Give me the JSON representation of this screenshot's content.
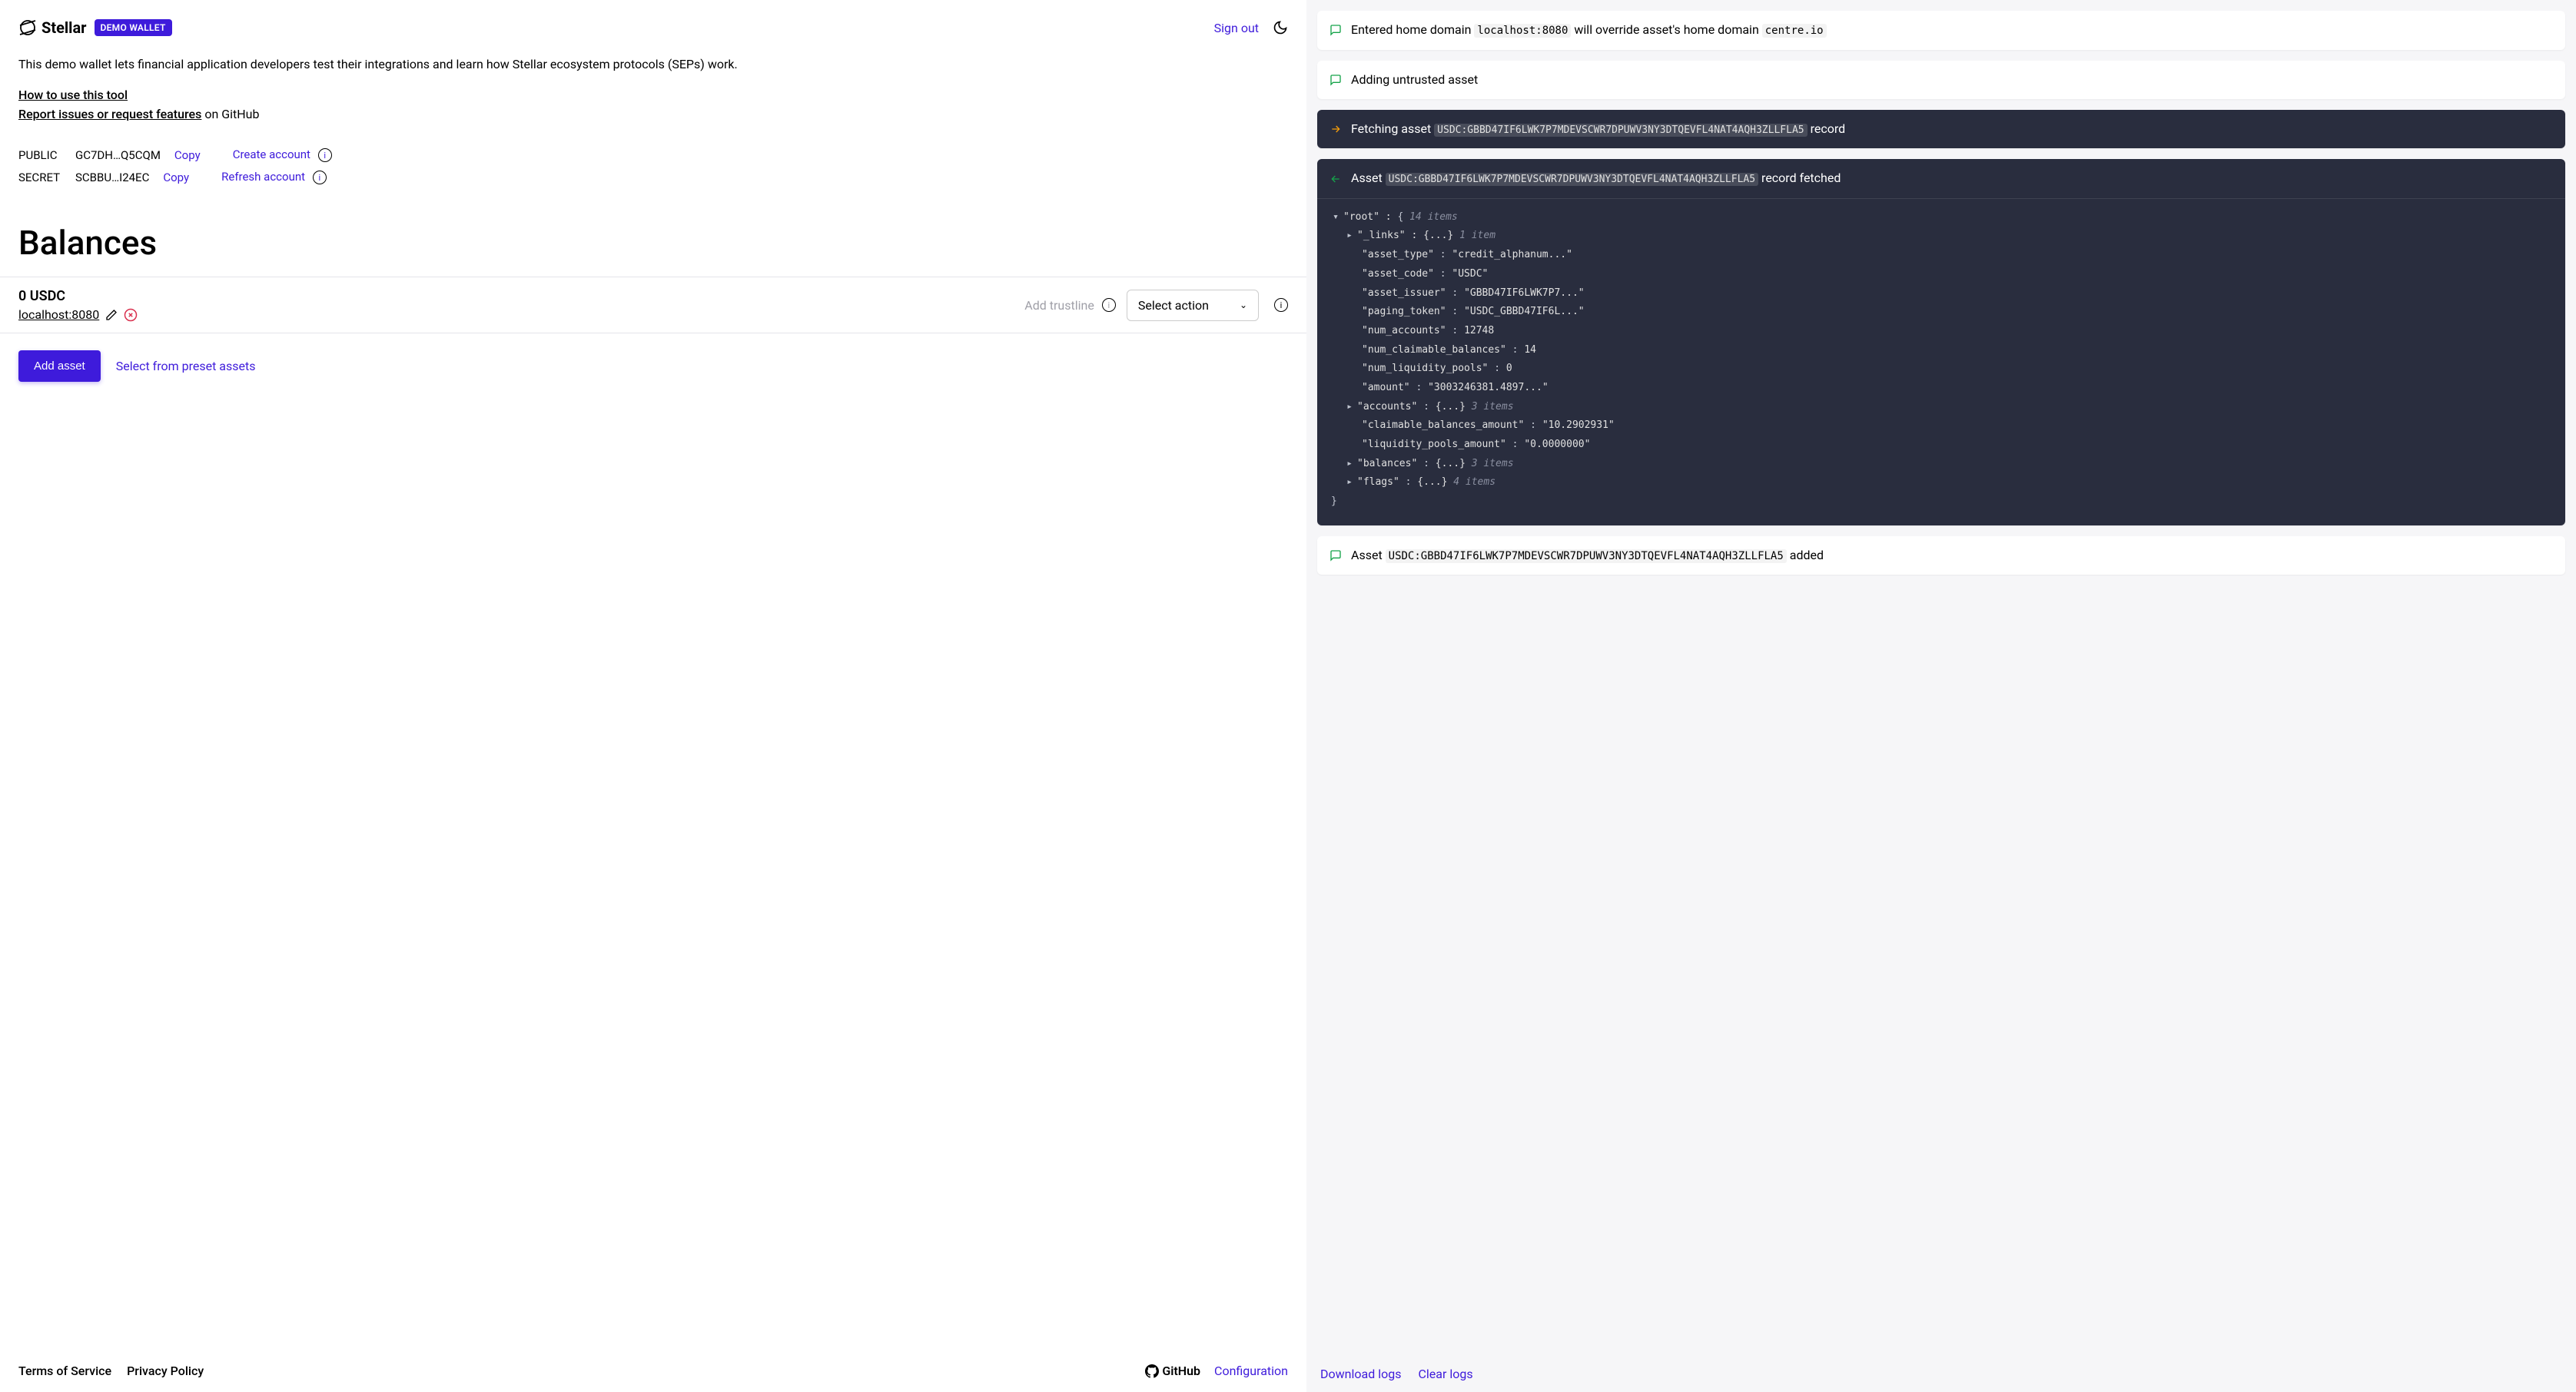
{
  "header": {
    "brand": "Stellar",
    "badge": "DEMO WALLET",
    "signout": "Sign out"
  },
  "intro": "This demo wallet lets financial application developers test their integrations and learn how Stellar ecosystem protocols (SEPs) work.",
  "links": {
    "howto": "How to use this tool",
    "report": "Report issues or request features",
    "on_github": "on GitHub"
  },
  "keys": {
    "public_label": "PUBLIC",
    "public_value": "GC7DH…Q5CQM",
    "secret_label": "SECRET",
    "secret_value": "SCBBU…I24EC",
    "copy": "Copy",
    "create": "Create account",
    "refresh": "Refresh account"
  },
  "balances": {
    "heading": "Balances",
    "amount": "0 USDC",
    "domain": "localhost:8080",
    "add_trustline": "Add trustline",
    "select_action": "Select action",
    "add_asset": "Add asset",
    "preset": "Select from preset assets"
  },
  "footer": {
    "terms": "Terms of Service",
    "privacy": "Privacy Policy",
    "github": "GitHub",
    "config": "Configuration"
  },
  "logs": {
    "download": "Download logs",
    "clear": "Clear logs",
    "items": {
      "entered_pre": "Entered home domain ",
      "entered_code1": "localhost:8080",
      "entered_mid": " will override asset's home domain ",
      "entered_code2": "centre.io",
      "adding": "Adding untrusted asset",
      "fetching_pre": "Fetching asset ",
      "fetching_code": "USDC:GBBD47IF6LWK7P7MDEVSCWR7DPUWV3NY3DTQEVFL4NAT4AQH3ZLLFLA5",
      "fetching_post": " record",
      "fetched_pre": "Asset ",
      "fetched_code": "USDC:GBBD47IF6LWK7P7MDEVSCWR7DPUWV3NY3DTQEVFL4NAT4AQH3ZLLFLA5",
      "fetched_post": " record fetched",
      "added_pre": "Asset ",
      "added_code": "USDC:GBBD47IF6LWK7P7MDEVSCWR7DPUWV3NY3DTQEVFL4NAT4AQH3ZLLFLA5",
      "added_post": " added"
    }
  },
  "json_view": {
    "root_label": "\"root\" :",
    "root_open": "{",
    "root_count": "14 items",
    "links_label": "\"_links\" :",
    "links_val": "{...}",
    "links_count": "1 item",
    "asset_type_k": "\"asset_type\"",
    "asset_type_v": "\"credit_alphanum...\"",
    "asset_code_k": "\"asset_code\"",
    "asset_code_v": "\"USDC\"",
    "asset_issuer_k": "\"asset_issuer\"",
    "asset_issuer_v": "\"GBBD47IF6LWK7P7...\"",
    "paging_token_k": "\"paging_token\"",
    "paging_token_v": "\"USDC_GBBD47IF6L...\"",
    "num_accounts_k": "\"num_accounts\"",
    "num_accounts_v": "12748",
    "num_claimable_k": "\"num_claimable_balances\"",
    "num_claimable_v": "14",
    "num_liquidity_k": "\"num_liquidity_pools\"",
    "num_liquidity_v": "0",
    "amount_k": "\"amount\"",
    "amount_v": "\"3003246381.4897...\"",
    "accounts_k": "\"accounts\"",
    "accounts_v": "{...}",
    "accounts_count": "3 items",
    "claimable_amt_k": "\"claimable_balances_amount\"",
    "claimable_amt_v": "\"10.2902931\"",
    "liquidity_amt_k": "\"liquidity_pools_amount\"",
    "liquidity_amt_v": "\"0.0000000\"",
    "balances_k": "\"balances\"",
    "balances_v": "{...}",
    "balances_count": "3 items",
    "flags_k": "\"flags\"",
    "flags_v": "{...}",
    "flags_count": "4 items",
    "close": "}"
  }
}
